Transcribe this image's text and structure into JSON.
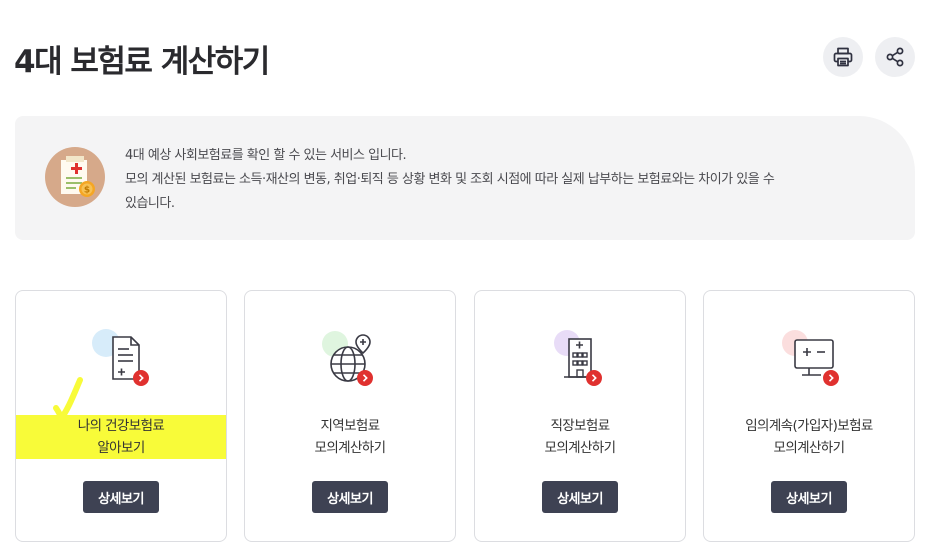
{
  "header": {
    "title": "4대 보험료 계산하기",
    "print_icon": "printer-icon",
    "share_icon": "share-icon"
  },
  "notice": {
    "icon": "insurance-document-coin-icon",
    "line1": "4대 예상 사회보험료를 확인 할 수 있는 서비스 입니다.",
    "line2": "모의 계산된 보험료는 소득·재산의 변동, 취업·퇴직 등 상황 변화 및 조회 시점에 따라 실제 납부하는 보험료와는 차이가 있을 수",
    "line3": "있습니다."
  },
  "cards": [
    {
      "icon": "document-icon",
      "label_line1": "나의 건강보험료",
      "label_line2": "알아보기",
      "button": "상세보기",
      "highlight_color": "#f8fb39"
    },
    {
      "icon": "globe-icon",
      "label_line1": "지역보험료",
      "label_line2": "모의계산하기",
      "button": "상세보기"
    },
    {
      "icon": "building-icon",
      "label_line1": "직장보험료",
      "label_line2": "모의계산하기",
      "button": "상세보기"
    },
    {
      "icon": "monitor-icon",
      "label_line1": "임의계속(가입자)보험료",
      "label_line2": "모의계산하기",
      "button": "상세보기"
    }
  ],
  "colors": {
    "button_bg": "#3e4253",
    "badge_red": "#e0312f",
    "notice_bg": "#f4f4f5",
    "highlight": "#f8fb39"
  }
}
